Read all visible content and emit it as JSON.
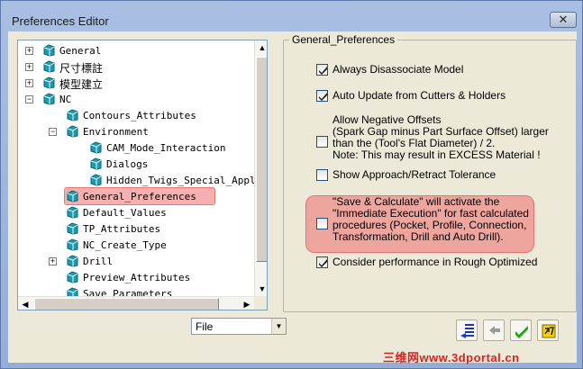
{
  "window": {
    "title": "Preferences Editor",
    "close_glyph": "✕"
  },
  "tree": {
    "nodes": [
      {
        "label": "General",
        "expander": "+"
      },
      {
        "label": "尺寸標註",
        "expander": "+"
      },
      {
        "label": "模型建立",
        "expander": "+"
      },
      {
        "label": "NC",
        "expander": "−"
      },
      {
        "label": "Contours_Attributes"
      },
      {
        "label": "Environment",
        "expander": "−"
      },
      {
        "label": "CAM_Mode_Interaction"
      },
      {
        "label": "Dialogs"
      },
      {
        "label": "Hidden_Twigs_Special_Appli"
      },
      {
        "label": "General_Preferences",
        "selected": true
      },
      {
        "label": "Default_Values"
      },
      {
        "label": "TP_Attributes"
      },
      {
        "label": "NC_Create_Type"
      },
      {
        "label": "Drill",
        "expander": "+"
      },
      {
        "label": "Preview_Attributes"
      },
      {
        "label": "Save_Parameters"
      }
    ]
  },
  "panel": {
    "group_title": "General_Preferences",
    "options": [
      {
        "text": "Always Disassociate Model",
        "checked": true
      },
      {
        "text": "Auto Update from Cutters & Holders",
        "checked": true
      },
      {
        "text": "Allow Negative Offsets\n(Spark Gap minus Part Surface Offset) larger\nthan the (Tool's Flat Diameter) / 2.\nNote: This may result in EXCESS Material !",
        "checked": false
      },
      {
        "text": "Show Approach/Retract Tolerance",
        "checked": false
      },
      {
        "text": "\"Save & Calculate\" will activate the\n\"Immediate Execution\" for fast calculated\nprocedures (Pocket, Profile, Connection,\nTransformation, Drill and Auto Drill).",
        "checked": false
      },
      {
        "text": "Consider performance in Rough Optimized",
        "checked": true
      }
    ]
  },
  "bottom": {
    "combo_value": "File",
    "tools": [
      "import-icon",
      "export-icon",
      "ok-check-icon",
      "reset-icon"
    ]
  },
  "watermark": "三维网www.3dportal.cn",
  "colors": {
    "highlight": "#f06e6e",
    "check_green": "#1aa51a",
    "folder_teal": "#1a9cb0"
  }
}
